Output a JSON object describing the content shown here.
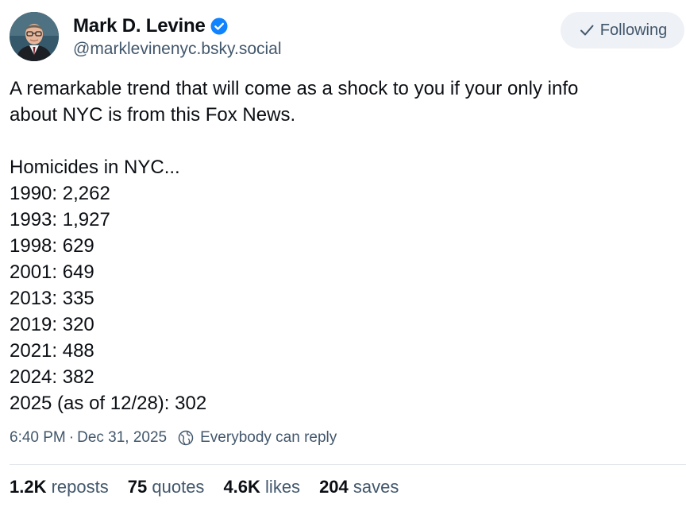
{
  "author": {
    "display_name": "Mark D. Levine",
    "handle": "@marklevinenyc.bsky.social",
    "verified": true,
    "verified_color": "#1083fe"
  },
  "follow_button": {
    "label": "Following",
    "icon": "checkmark-icon"
  },
  "post": {
    "intro_lines": [
      "A remarkable trend that will come as a shock to you if your only info",
      "about NYC is from this Fox News."
    ],
    "list_heading": "Homicides in NYC...",
    "list_lines": [
      "1990: 2,262",
      "1993: 1,927",
      "1998: 629",
      "2001: 649",
      "2013: 335",
      "2019: 320",
      "2021: 488",
      "2024: 382",
      "2025 (as of 12/28): 302"
    ]
  },
  "meta": {
    "time": "6:40 PM",
    "separator": "·",
    "date": "Dec 31, 2025",
    "reply_setting": "Everybody can reply",
    "reply_icon": "globe-icon"
  },
  "stats": [
    {
      "count": "1.2K",
      "label": "reposts"
    },
    {
      "count": "75",
      "label": "quotes"
    },
    {
      "count": "4.6K",
      "label": "likes"
    },
    {
      "count": "204",
      "label": "saves"
    }
  ],
  "colors": {
    "text_primary": "#0b0f14",
    "text_secondary": "#42576c",
    "button_bg": "#eef1f5",
    "divider": "#e4e8ec"
  }
}
